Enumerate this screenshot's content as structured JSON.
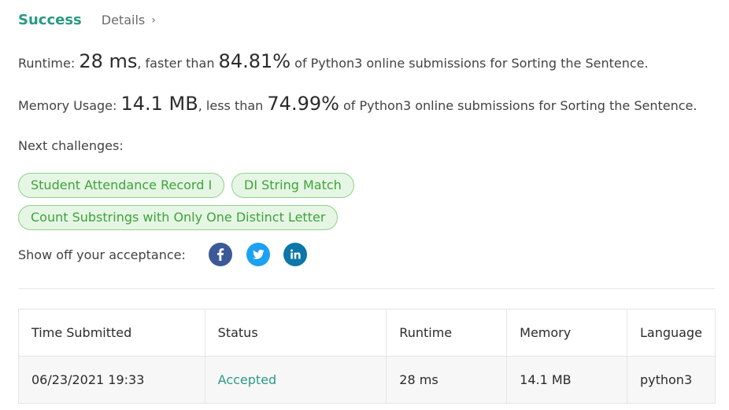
{
  "header": {
    "success_label": "Success",
    "details_label": "Details",
    "details_chevron": "›"
  },
  "runtime": {
    "label": "Runtime: ",
    "value": "28 ms",
    "mid": ", faster than ",
    "percent": "84.81%",
    "tail": " of Python3 online submissions for Sorting the Sentence."
  },
  "memory": {
    "label": "Memory Usage: ",
    "value": "14.1 MB",
    "mid": ", less than ",
    "percent": "74.99%",
    "tail": " of Python3 online submissions for Sorting the Sentence."
  },
  "next_challenges": {
    "label": "Next challenges:",
    "items": [
      "Student Attendance Record I",
      "DI String Match",
      "Count Substrings with Only One Distinct Letter"
    ]
  },
  "share": {
    "label": "Show off your acceptance:",
    "icons": [
      {
        "name": "facebook-icon",
        "color": "#3b5998"
      },
      {
        "name": "twitter-icon",
        "color": "#1da1f2"
      },
      {
        "name": "linkedin-icon",
        "color": "#0e76a8"
      }
    ]
  },
  "table": {
    "headers": [
      "Time Submitted",
      "Status",
      "Runtime",
      "Memory",
      "Language"
    ],
    "rows": [
      [
        "06/23/2021 19:33",
        "Accepted",
        "28 ms",
        "14.1 MB",
        "python3"
      ]
    ]
  },
  "colors": {
    "accent": "#2a9a85",
    "chip_bg": "#e6f6e4",
    "chip_border": "#8ed08c",
    "chip_text": "#3da33a"
  }
}
